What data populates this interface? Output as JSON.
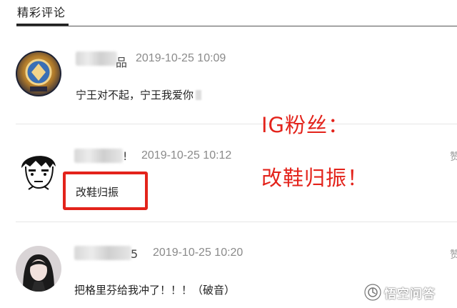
{
  "section": {
    "title": "精彩评论"
  },
  "comments": [
    {
      "name_visible_tail": "品",
      "timestamp": "2019-10-25 10:09",
      "text": "宁王对不起，宁王我爱你",
      "avatar_icon": "ig-team-emblem-avatar"
    },
    {
      "name_visible_tail": "!",
      "timestamp": "2019-10-25 10:12",
      "text": "改鞋归振",
      "avatar_icon": "cartoon-boy-avatar"
    },
    {
      "name_visible_tail": "5",
      "timestamp": "2019-10-25 10:20",
      "text": "把格里芬给我冲了！！！（破音）",
      "avatar_icon": "girl-photo-avatar"
    }
  ],
  "annotation": {
    "line1": "IG粉丝：",
    "line2": "改鞋归振！",
    "color": "#e3231b"
  },
  "side_cut_chars": [
    "赞",
    "赞"
  ],
  "watermark": {
    "text": "悟空问答"
  }
}
